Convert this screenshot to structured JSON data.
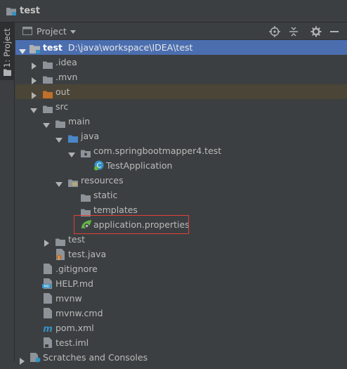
{
  "window": {
    "title": "test"
  },
  "sidebar": {
    "tab_label": "1: Project"
  },
  "panel": {
    "title": "Project"
  },
  "toolbar_icons": [
    "locate-icon",
    "collapse-all-icon",
    "settings-icon",
    "hide-icon"
  ],
  "tree": {
    "root": {
      "name": "test",
      "path": "D:\\java\\workspace\\IDEA\\test"
    },
    "items": [
      {
        "label": ".idea"
      },
      {
        "label": ".mvn"
      },
      {
        "label": "out"
      },
      {
        "label": "src"
      },
      {
        "label": "main"
      },
      {
        "label": "java"
      },
      {
        "label": "com.springbootmapper4.test"
      },
      {
        "label": "TestApplication"
      },
      {
        "label": "resources"
      },
      {
        "label": "static"
      },
      {
        "label": "templates"
      },
      {
        "label": "application.properties"
      },
      {
        "label": "test"
      },
      {
        "label": "test.java"
      },
      {
        "label": ".gitignore"
      },
      {
        "label": "HELP.md"
      },
      {
        "label": "mvnw"
      },
      {
        "label": "mvnw.cmd"
      },
      {
        "label": "pom.xml"
      },
      {
        "label": "test.iml"
      },
      {
        "label": "Scratches and Consoles"
      }
    ]
  },
  "colors": {
    "background": "#3c3f41",
    "selection": "#4b6eaf",
    "excluded_row": "#4a4537",
    "highlight_border": "#e0403a",
    "folder": "#8d9399",
    "excluded_folder": "#c0702a"
  }
}
